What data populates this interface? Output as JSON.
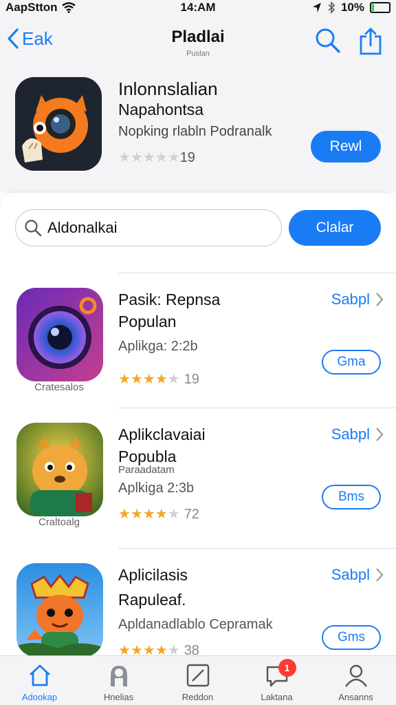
{
  "status_bar": {
    "carrier": "AapStton",
    "time": "14:AM",
    "battery": "10%",
    "battery_level": 0.1,
    "battery_color": "#34c759"
  },
  "header": {
    "back_label": "Eak",
    "title": "Pladlai",
    "subtitle": "Puslan",
    "icons": [
      "search-icon",
      "share-icon"
    ]
  },
  "featured": {
    "icon": "camera-cat-icon",
    "title": "Inlonnslalian",
    "subtitle": "Napahontsa",
    "description": "Nopking rlabln Podranalk",
    "rating_count": "19",
    "rating": 0,
    "button_label": "Rewl"
  },
  "search": {
    "value": "Aldonalkai",
    "button_label": "Clalar"
  },
  "list": [
    {
      "icon": "camera-lens-icon",
      "caption": "Cratesalos",
      "title": "Pasik: Repnsa",
      "subtitle": "Populan",
      "small_text": "",
      "meta": "Aplikga: 2:2b",
      "rating": 3.5,
      "rating_count": "19",
      "link_label": "Sabpl",
      "button_label": "Gma"
    },
    {
      "icon": "lion-mascot-icon",
      "caption": "Craltoalg",
      "title": "Aplikclavaiai",
      "subtitle": "Popubla",
      "small_text": "Paraadatam",
      "meta": "Aplkiga 2:3b",
      "rating": 3.5,
      "rating_count": "72",
      "link_label": "Sabpl",
      "button_label": "Bms"
    },
    {
      "icon": "fox-mascot-icon",
      "caption": "",
      "title": "Aplicilasis",
      "subtitle": "Rapuleaf.",
      "small_text": "",
      "meta": "Apldanadlablo Cepramak",
      "rating": 3.5,
      "rating_count": "38",
      "link_label": "Sabpl",
      "button_label": "Gms"
    }
  ],
  "tabs": [
    {
      "label": "Adookap",
      "icon": "home-icon",
      "active": true,
      "badge": ""
    },
    {
      "label": "Hnelias",
      "icon": "person-icon",
      "active": false,
      "badge": ""
    },
    {
      "label": "Reddon",
      "icon": "edit-icon",
      "active": false,
      "badge": ""
    },
    {
      "label": "Laktana",
      "icon": "chat-icon",
      "active": false,
      "badge": "1"
    },
    {
      "label": "Ansanns",
      "icon": "account-icon",
      "active": false,
      "badge": ""
    }
  ],
  "colors": {
    "accent": "#1a7cf5",
    "star": "#f5a623",
    "badge": "#ff3b30"
  }
}
